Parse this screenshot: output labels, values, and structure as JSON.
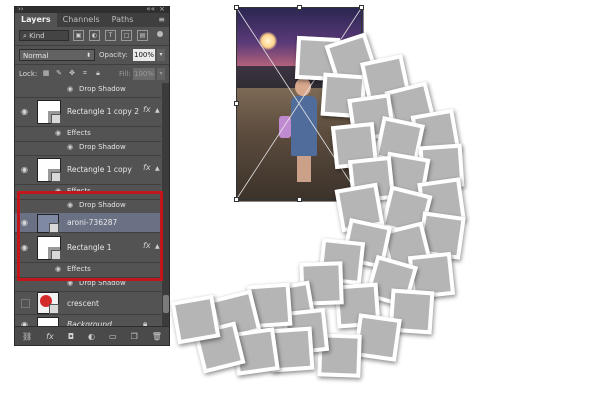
{
  "panel": {
    "tabs": [
      "Layers",
      "Channels",
      "Paths"
    ],
    "kind_label": "Kind",
    "blend_mode": "Normal",
    "opacity_label": "Opacity:",
    "opacity_value": "100%",
    "lock_label": "Lock:",
    "fill_label": "Fill:",
    "fill_value": "100%"
  },
  "layers": {
    "top_effect": "Drop Shadow",
    "copy2": {
      "name": "Rectangle 1 copy 2",
      "effects": "Effects",
      "effect": "Drop Shadow"
    },
    "copy": {
      "name": "Rectangle 1 copy",
      "effects": "Effects",
      "effect": "Drop Shadow"
    },
    "aroni": {
      "name": "aroni-736287"
    },
    "rect1": {
      "name": "Rectangle 1",
      "effects": "Effects",
      "effect": "Drop Shadow"
    },
    "crescent": {
      "name": "crescent"
    },
    "background": {
      "name": "Background"
    }
  },
  "icons": {
    "fx": "fx",
    "eye": "◉",
    "link": "link-icon",
    "fx_button": "fx-icon",
    "mask": "mask-icon",
    "adjust": "adjustment-icon",
    "group": "folder-icon",
    "new": "new-layer-icon",
    "trash": "trash-icon"
  },
  "colors": {
    "panel_bg": "#535353",
    "selected_layer": "#6a7184",
    "highlight_box": "#c3161c",
    "frame_fill": "#b5b5b5"
  }
}
